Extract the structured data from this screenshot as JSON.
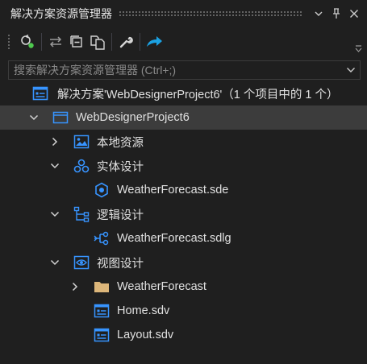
{
  "window": {
    "title": "解决方案资源管理器",
    "pin_icon": "pin-icon",
    "close_icon": "close-icon",
    "dropdown_icon": "window-menu-chevron-icon"
  },
  "toolbar": {
    "buttons": [
      {
        "name": "sync-with-active-document",
        "icon": "sync-icon"
      },
      {
        "name": "pending-changes-filter",
        "icon": "swap-arrows-icon"
      },
      {
        "name": "collapse-all",
        "icon": "collapse-all-icon"
      },
      {
        "name": "show-all-files",
        "icon": "copy-pages-icon"
      },
      {
        "name": "properties",
        "icon": "wrench-icon"
      },
      {
        "name": "publish",
        "icon": "publish-arrow-icon"
      }
    ],
    "colors": {
      "icon": "#d4d4d4",
      "green": "#4ec94e",
      "blue": "#1ba1e2"
    }
  },
  "search": {
    "placeholder": "搜索解决方案资源管理器 (Ctrl+;)",
    "value": ""
  },
  "tree": {
    "solution_label": "解决方案'WebDesignerProject6'（1 个项目中的 1 个）",
    "project_label": "WebDesignerProject6",
    "local_resources": "本地资源",
    "entity_design": "实体设计",
    "entity_file": "WeatherForecast.sde",
    "logic_design": "逻辑设计",
    "logic_file": "WeatherForecast.sdlg",
    "view_design": "视图设计",
    "view_folder": "WeatherForecast",
    "home_file": "Home.sdv",
    "layout_file": "Layout.sdv"
  },
  "colors": {
    "background": "#1f1f1f",
    "selected_row": "#3c3c3c",
    "accent_blue": "#3794ff",
    "folder": "#dcb67a"
  }
}
